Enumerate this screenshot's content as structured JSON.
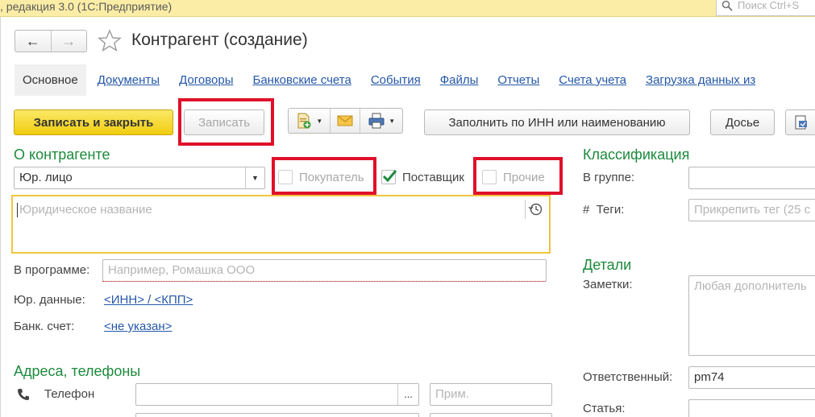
{
  "titlebar": {
    "title": ", редакция 3.0  (1С:Предприятие)",
    "search_placeholder": "Поиск Ctrl+S"
  },
  "form": {
    "title": "Контрагент (создание)",
    "tabs": [
      {
        "label": "Основное",
        "active": true
      },
      {
        "label": "Документы"
      },
      {
        "label": "Договоры"
      },
      {
        "label": "Банковские счета"
      },
      {
        "label": "События"
      },
      {
        "label": "Файлы"
      },
      {
        "label": "Отчеты"
      },
      {
        "label": "Счета учета"
      },
      {
        "label": "Загрузка данных из"
      }
    ]
  },
  "toolbar": {
    "save_close_label": "Записать и закрыть",
    "save_label": "Записать",
    "fill_label": "Заполнить по ИНН или наименованию",
    "dossier_label": "Досье"
  },
  "about": {
    "section_title": "О контрагенте",
    "entity_type": "Юр. лицо",
    "buyer_label": "Покупатель",
    "supplier_label": "Поставщик",
    "supplier_checked": true,
    "other_label": "Прочие",
    "name_placeholder": "Юридическое название",
    "in_program_label": "В программе:",
    "in_program_placeholder": "Например, Ромашка ООО",
    "legal_data_label": "Юр. данные:",
    "legal_data_link": "<ИНН> / <КПП>",
    "bank_account_label": "Банк. счет:",
    "bank_account_link": "<не указан>"
  },
  "addresses": {
    "section_title": "Адреса, телефоны",
    "phone_label": "Телефон",
    "phone_value": "",
    "note_placeholder": "Прим."
  },
  "classification": {
    "section_title": "Классификация",
    "group_label": "В группе:",
    "group_value": "",
    "tags_label": "Теги:",
    "tags_placeholder": "Прикрепить тег (25 с"
  },
  "details": {
    "section_title": "Детали",
    "notes_label": "Заметки:",
    "notes_placeholder": "Любая дополнитель",
    "responsible_label": "Ответственный:",
    "responsible_value": "pm74",
    "article_label": "Статья:"
  },
  "colors": {
    "accent_green": "#1d8a3c",
    "link_blue": "#2558a8",
    "highlight_red": "#e0102a",
    "primary_yellow": "#f1cd0f"
  }
}
